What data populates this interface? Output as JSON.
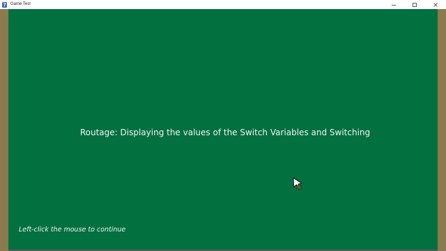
{
  "window": {
    "title": "Game Test",
    "app_icon": "game-app-icon",
    "controls": {
      "minimize_icon": "minimize-icon",
      "maximize_icon": "maximize-icon",
      "close_icon": "close-icon"
    }
  },
  "game": {
    "title": "Routage: Displaying the values of the Switch Variables and Switching",
    "hint": "Left-click the mouse to continue",
    "cursor_icon": "mouse-cursor-icon"
  },
  "colors": {
    "frame": "#8a7a4e",
    "game_background": "#037040",
    "text": "#f3f3f3",
    "titlebar": "#ffffff"
  }
}
